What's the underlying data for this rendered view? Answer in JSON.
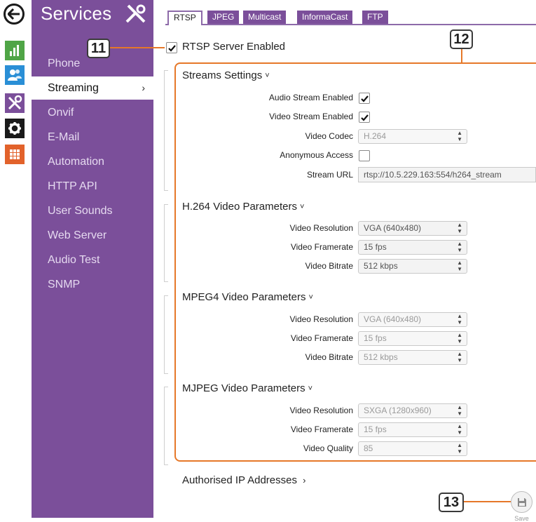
{
  "sidebar": {
    "title": "Services",
    "items": [
      {
        "label": "Phone"
      },
      {
        "label": "Streaming",
        "active": true
      },
      {
        "label": "Onvif"
      },
      {
        "label": "E-Mail"
      },
      {
        "label": "Automation"
      },
      {
        "label": "HTTP API"
      },
      {
        "label": "User Sounds"
      },
      {
        "label": "Web Server"
      },
      {
        "label": "Audio Test"
      },
      {
        "label": "SNMP"
      }
    ],
    "active_chevron": "›"
  },
  "rail": {
    "icons": [
      "back-arrow-icon",
      "bar-chart-icon",
      "users-icon",
      "tools-icon",
      "gear-icon",
      "grid-icon"
    ],
    "colors": {
      "chart": "#4fa546",
      "users": "#2a8fd6",
      "tools": "#7b4f9a",
      "gear": "#1a1a1a",
      "grid": "#e2622b"
    }
  },
  "tabs": [
    {
      "label": "RTSP",
      "active": true
    },
    {
      "label": "JPEG"
    },
    {
      "label": "Multicast"
    },
    {
      "label": "InformaCast"
    },
    {
      "label": "FTP"
    }
  ],
  "rtsp_enabled": {
    "label": "RTSP Server Enabled",
    "checked": true
  },
  "annotations": {
    "a11": "11",
    "a12": "12",
    "a13": "13",
    "color": "#e67829"
  },
  "streams": {
    "title": "Streams Settings",
    "audio_label": "Audio Stream Enabled",
    "audio_checked": true,
    "video_label": "Video Stream Enabled",
    "video_checked": true,
    "codec_label": "Video Codec",
    "codec_value": "H.264",
    "anon_label": "Anonymous Access",
    "anon_checked": false,
    "url_label": "Stream URL",
    "url_value": "rtsp://10.5.229.163:554/h264_stream"
  },
  "h264": {
    "title": "H.264 Video Parameters",
    "res_label": "Video Resolution",
    "res_value": "VGA (640x480)",
    "fps_label": "Video Framerate",
    "fps_value": "15 fps",
    "bitrate_label": "Video Bitrate",
    "bitrate_value": "512 kbps"
  },
  "mpeg4": {
    "title": "MPEG4 Video Parameters",
    "res_label": "Video Resolution",
    "res_value": "VGA (640x480)",
    "fps_label": "Video Framerate",
    "fps_value": "15 fps",
    "bitrate_label": "Video Bitrate",
    "bitrate_value": "512 kbps"
  },
  "mjpeg": {
    "title": "MJPEG Video Parameters",
    "res_label": "Video Resolution",
    "res_value": "SXGA (1280x960)",
    "fps_label": "Video Framerate",
    "fps_value": "15 fps",
    "quality_label": "Video Quality",
    "quality_value": "85"
  },
  "caret_down": "˅",
  "authorised": {
    "label": "Authorised IP Addresses",
    "chevron": "›"
  },
  "save": {
    "label": "Save"
  }
}
